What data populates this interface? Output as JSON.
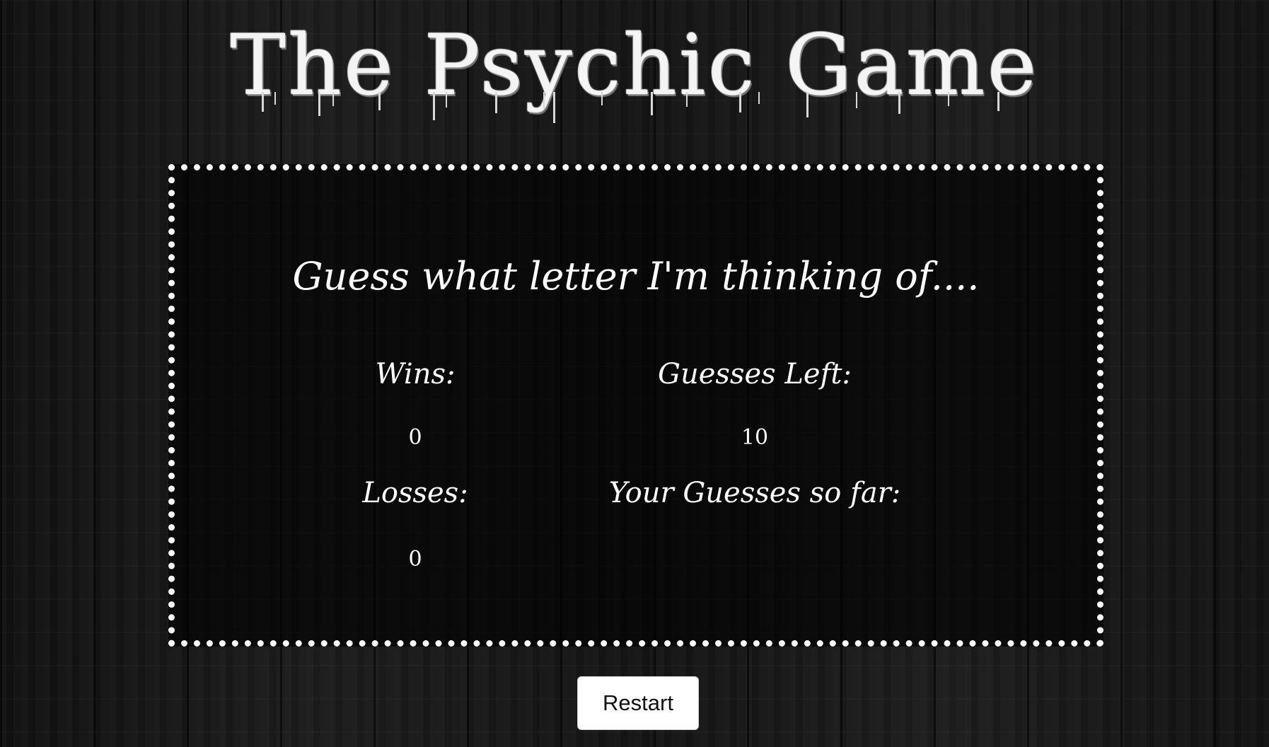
{
  "header": {
    "title": "The Psychic Game"
  },
  "game": {
    "prompt": "Guess what letter I'm thinking of....",
    "wins_label": "Wins:",
    "wins_value": "0",
    "losses_label": "Losses:",
    "losses_value": "0",
    "guesses_left_label": "Guesses Left:",
    "guesses_left_value": "10",
    "guesses_so_far_label": "Your Guesses so far:",
    "guesses_so_far_value": ""
  },
  "controls": {
    "restart_label": "Restart"
  },
  "colors": {
    "background": "#151515",
    "text": "#ffffff",
    "box_border": "#ffffff",
    "button_bg": "#ffffff",
    "button_text": "#111111"
  }
}
